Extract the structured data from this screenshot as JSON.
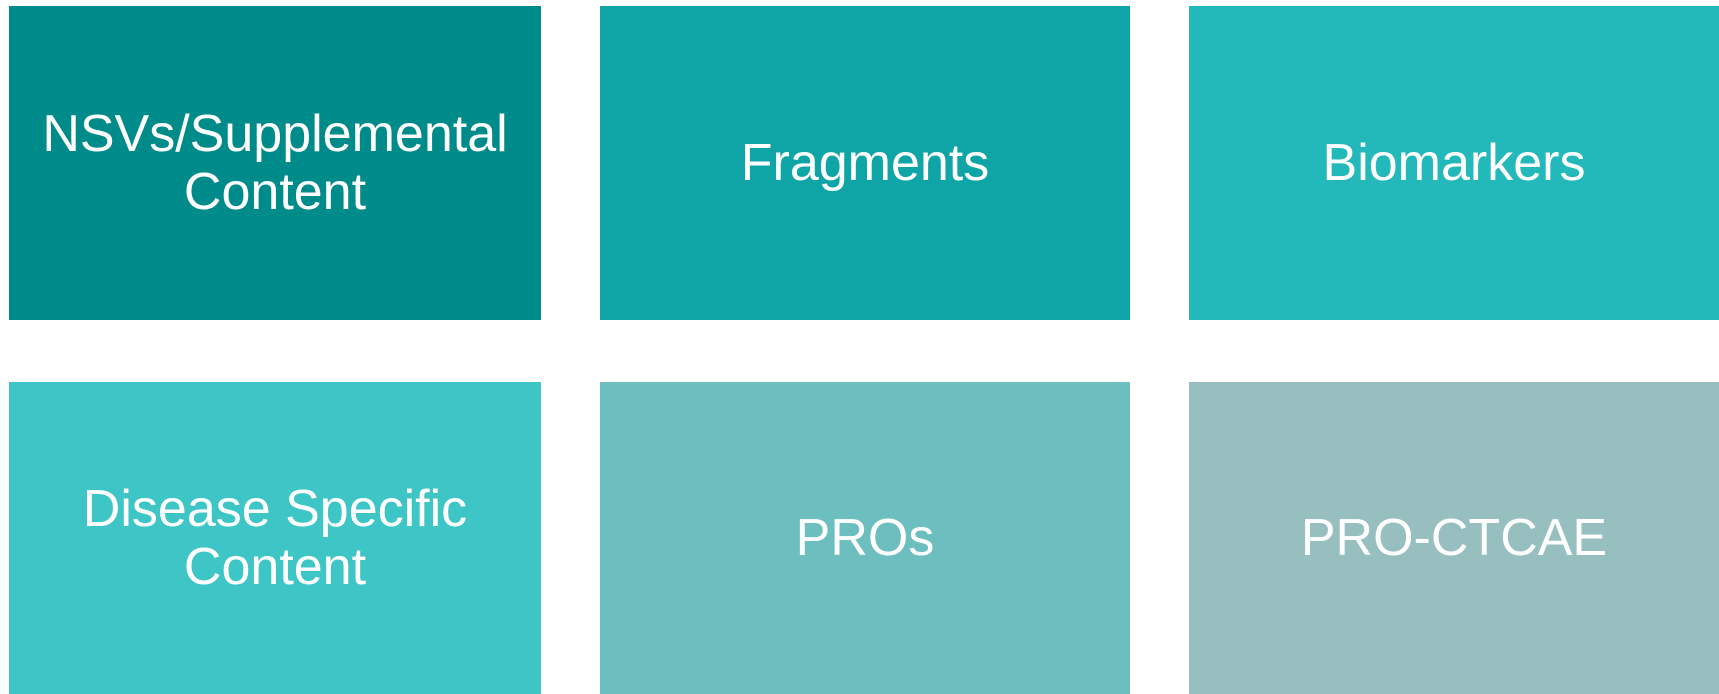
{
  "tiles": [
    {
      "label": "NSVs/Supplemental\nContent",
      "color": "#008b8b"
    },
    {
      "label": "Fragments",
      "color": "#0fa5a7"
    },
    {
      "label": "Biomarkers",
      "color": "#23b8b9"
    },
    {
      "label": "Disease Specific\nContent",
      "color": "#3ec6c6"
    },
    {
      "label": "PROs",
      "color": "#6dbfbf"
    },
    {
      "label": "PRO-CTCAE",
      "color": "#97bfbf"
    }
  ]
}
